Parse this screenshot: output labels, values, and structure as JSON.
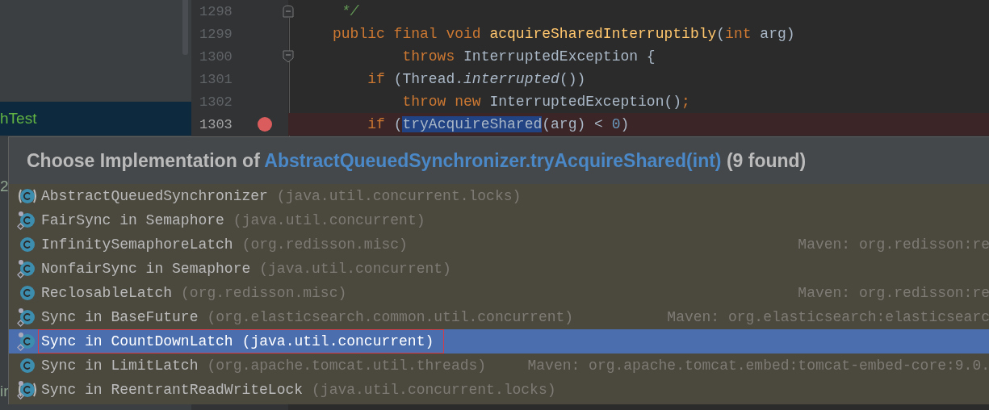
{
  "project_tree": {
    "items": [
      {
        "label": "hTest",
        "selected": true
      },
      {
        "label": "2",
        "selected": false
      },
      {
        "label": "ir",
        "selected": false
      }
    ]
  },
  "editor": {
    "lines": [
      {
        "number": "1298",
        "current": false,
        "breakpoint": false,
        "kind": "fold_end",
        "tokens": [
          {
            "text": " */",
            "kind": "comment"
          }
        ]
      },
      {
        "number": "1299",
        "current": false,
        "breakpoint": false,
        "kind": "plain",
        "tokens": [
          {
            "text": "public final void ",
            "kind": "keyword"
          },
          {
            "text": "acquireSharedInterruptibly",
            "kind": "method"
          },
          {
            "text": "(",
            "kind": "plain"
          },
          {
            "text": "int ",
            "kind": "keyword"
          },
          {
            "text": "arg)",
            "kind": "plain"
          }
        ]
      },
      {
        "number": "1300",
        "current": false,
        "breakpoint": false,
        "kind": "fold_start",
        "tokens": [
          {
            "text": "        throws ",
            "kind": "keyword"
          },
          {
            "text": "InterruptedException {",
            "kind": "plain"
          }
        ]
      },
      {
        "number": "1301",
        "current": false,
        "breakpoint": false,
        "kind": "plain",
        "tokens": [
          {
            "text": "    if ",
            "kind": "keyword"
          },
          {
            "text": "(Thread.",
            "kind": "plain"
          },
          {
            "text": "interrupted",
            "kind": "italic"
          },
          {
            "text": "())",
            "kind": "plain"
          }
        ]
      },
      {
        "number": "1302",
        "current": false,
        "breakpoint": false,
        "kind": "plain",
        "tokens": [
          {
            "text": "        throw new ",
            "kind": "keyword"
          },
          {
            "text": "InterruptedException()",
            "kind": "plain"
          },
          {
            "text": ";",
            "kind": "keyword"
          }
        ]
      },
      {
        "number": "1303",
        "current": true,
        "breakpoint": true,
        "kind": "plain",
        "tokens": [
          {
            "text": "    if ",
            "kind": "keyword"
          },
          {
            "text": "(",
            "kind": "plain"
          },
          {
            "text": "tryAcquireShared",
            "kind": "selection"
          },
          {
            "text": "(arg) < ",
            "kind": "plain"
          },
          {
            "text": "0",
            "kind": "number"
          },
          {
            "text": ")",
            "kind": "plain"
          }
        ]
      }
    ]
  },
  "popup": {
    "title": {
      "prefix": "Choose Implementation of ",
      "target": "AbstractQueuedSynchronizer.tryAcquireShared(int)",
      "suffix": " (9 found)"
    },
    "items": [
      {
        "kind": "abstract",
        "name": "AbstractQueuedSynchronizer",
        "package": "(java.util.concurrent.locks)",
        "selected": false,
        "outlined": false
      },
      {
        "kind": "inner",
        "name": "FairSync in Semaphore",
        "package": "(java.util.concurrent)",
        "selected": false,
        "outlined": false
      },
      {
        "kind": "class",
        "name": "InfinitySemaphoreLatch",
        "package": "(org.redisson.misc)",
        "library": "Maven: org.redisson:re",
        "selected": false,
        "outlined": false
      },
      {
        "kind": "inner",
        "name": "NonfairSync in Semaphore",
        "package": "(java.util.concurrent)",
        "selected": false,
        "outlined": false
      },
      {
        "kind": "class",
        "name": "ReclosableLatch",
        "package": "(org.redisson.misc)",
        "library": "Maven: org.redisson:re",
        "selected": false,
        "outlined": false
      },
      {
        "kind": "inner",
        "name": "Sync in BaseFuture",
        "package": "(org.elasticsearch.common.util.concurrent)",
        "library": "Maven: org.elasticsearch:elasticsearc",
        "selected": false,
        "outlined": false
      },
      {
        "kind": "inner",
        "name": "Sync in CountDownLatch",
        "package": "(java.util.concurrent)",
        "selected": true,
        "outlined": true
      },
      {
        "kind": "class",
        "name": "Sync in LimitLatch",
        "package": "(org.apache.tomcat.util.threads)",
        "library": "Maven: org.apache.tomcat.embed:tomcat-embed-core:9.0.",
        "selected": false,
        "outlined": false
      },
      {
        "kind": "inner_abstract",
        "name": "Sync in ReentrantReadWriteLock",
        "package": "(java.util.concurrent.locks)",
        "selected": false,
        "outlined": false
      }
    ]
  }
}
